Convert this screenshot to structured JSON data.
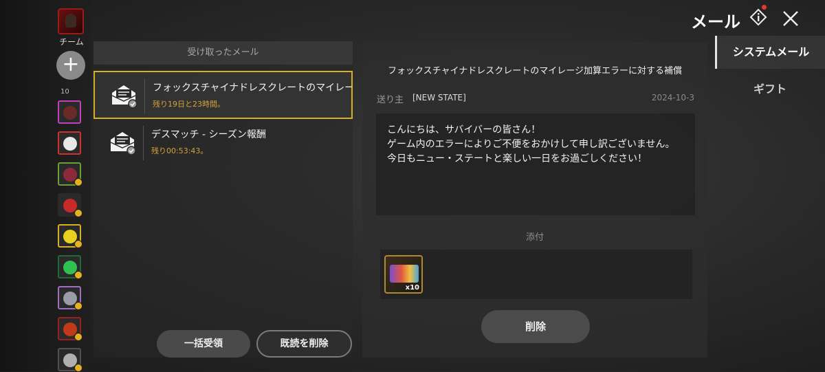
{
  "header": {
    "title": "メール",
    "info_icon": "info-diamond-icon",
    "close_icon": "close-icon",
    "notification_color": "#e53a2b"
  },
  "sidebar": {
    "team_label": "チーム",
    "add_icon": "+",
    "friend_count": "10",
    "friends": [
      {
        "frame": "#c040c0",
        "fill": "#6a2a2a"
      },
      {
        "frame": "#d03030",
        "fill": "#e8e8e8"
      },
      {
        "frame": "#6aa030",
        "fill": "#8a2a3a"
      },
      {
        "frame": "#2a2a2a",
        "fill": "#c82a2a"
      },
      {
        "frame": "#d8b020",
        "fill": "#e8d020"
      },
      {
        "frame": "#1f6a3a",
        "fill": "#30c050"
      },
      {
        "frame": "#a070c0",
        "fill": "#9a9aa8"
      },
      {
        "frame": "#9a2020",
        "fill": "#c03a1a"
      },
      {
        "frame": "#505050",
        "fill": "#b0b0b0"
      }
    ]
  },
  "mail_list": {
    "header": "受け取ったメール",
    "items": [
      {
        "title": "フォックスチャイナドレスクレートのマイレージ加算エラーに対する補償",
        "time_left": "残り19日と23時間。",
        "selected": true
      },
      {
        "title": "デスマッチ - シーズン報酬",
        "time_left": "残り00:53:43。",
        "selected": false
      }
    ],
    "receive_all_label": "一括受領",
    "delete_read_label": "既読を削除"
  },
  "detail": {
    "title": "フォックスチャイナドレスクレートのマイレージ加算エラーに対する補償",
    "sender_label": "送り主",
    "sender": "[NEW STATE]",
    "date": "2024-10-3",
    "body": [
      "こんにちは、サバイバーの皆さん！",
      "ゲーム内のエラーによりご不便をおかけして申し訳ございません。",
      "今日もニュー・ステートと楽しい一日をお過ごしください！"
    ],
    "attachment_label": "添付",
    "attachment_qty": "x10",
    "delete_label": "削除"
  },
  "tabs": {
    "system": "システムメール",
    "gift": "ギフト"
  },
  "colors": {
    "accent_gold": "#d9b021",
    "time_orange": "#d4a23a"
  }
}
